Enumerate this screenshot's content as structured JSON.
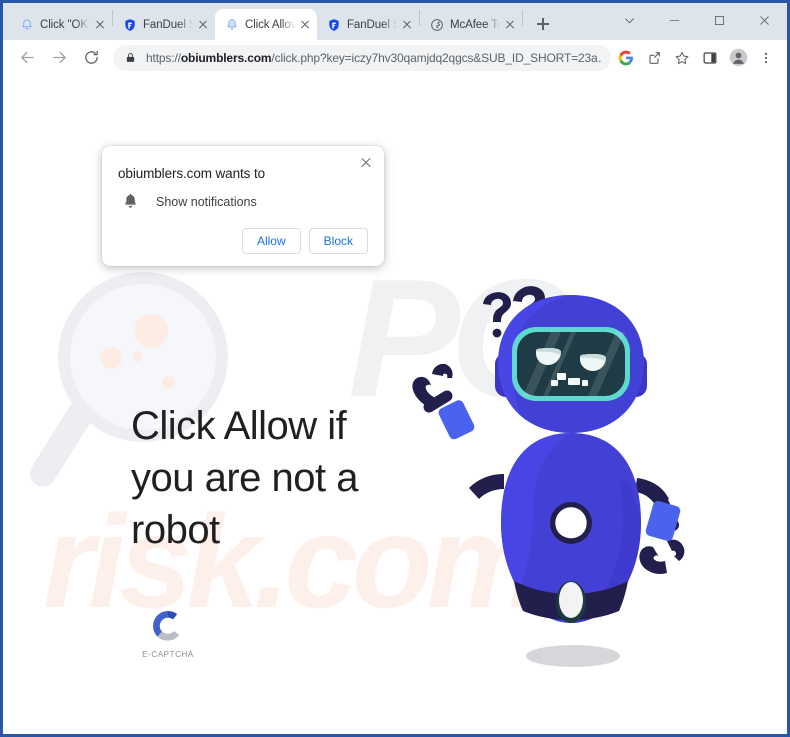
{
  "window": {
    "controls": [
      {
        "name": "tab-search",
        "glyph": "⌄"
      },
      {
        "name": "minimize",
        "glyph": "–"
      },
      {
        "name": "maximize",
        "glyph": "▢"
      },
      {
        "name": "close",
        "glyph": "✕"
      }
    ]
  },
  "tabs": [
    {
      "title": "Click \"OK\"",
      "favicon": "bell-icon",
      "active": false
    },
    {
      "title": "FanDuel Sp",
      "favicon": "fanduel-shield-icon",
      "active": false
    },
    {
      "title": "Click Allow",
      "favicon": "bell-icon",
      "active": true
    },
    {
      "title": "FanDuel Sp",
      "favicon": "fanduel-shield-icon",
      "active": false
    },
    {
      "title": "McAfee To",
      "favicon": "globe-icon",
      "active": false
    }
  ],
  "toolbar": {
    "back_label": "Back",
    "forward_label": "Forward",
    "reload_label": "Reload",
    "url_bold": "obiumblers.com",
    "url_prefix": "https://",
    "url_suffix": "/click.php?key=iczy7hv30qamjdq2qgcs&SUB_ID_SHORT=23a…",
    "url_full": "https://obiumblers.com/click.php?key=iczy7hv30qamjdq2qgcs&SUB_ID_SHORT=23a…",
    "icons": [
      {
        "name": "google-lens-icon",
        "label": "Search with Google Lens"
      },
      {
        "name": "share-icon",
        "label": "Share this page"
      },
      {
        "name": "bookmark-star-icon",
        "label": "Bookmark this tab"
      },
      {
        "name": "side-panel-icon",
        "label": "Side panel"
      },
      {
        "name": "profile-avatar-icon",
        "label": "Profile"
      },
      {
        "name": "more-menu-icon",
        "label": "Customize and control Google Chrome"
      }
    ]
  },
  "permission_bubble": {
    "title": "obiumblers.com wants to",
    "permission_label": "Show notifications",
    "permission_icon": "bell-icon",
    "allow_label": "Allow",
    "block_label": "Block",
    "close_label": "Close"
  },
  "page": {
    "headline": "Click Allow if you are not a robot",
    "captcha_label": "E-CAPTCHA",
    "watermark_pc": "PC",
    "watermark_risk": "risk.com",
    "robot_alt": "confused-robot-illustration",
    "question_marks": "??"
  },
  "colors": {
    "window_frame": "#2a56a8",
    "tab_strip": "#dee4ec",
    "omnibox_bg": "#f1f3f4",
    "link_blue": "#1a73e8",
    "robot_body": "#4340d6",
    "robot_body_light": "#4a47e8",
    "robot_dark": "#221f4d",
    "visor": "#1f3b45",
    "visor_border": "#5fd9cf",
    "heading_text": "#231f20",
    "watermark_gray": "#f0f1f3",
    "watermark_peach": "#fdf0ea",
    "captcha_blue": "#4a6fd0",
    "captcha_gray": "#b9bdc4"
  }
}
